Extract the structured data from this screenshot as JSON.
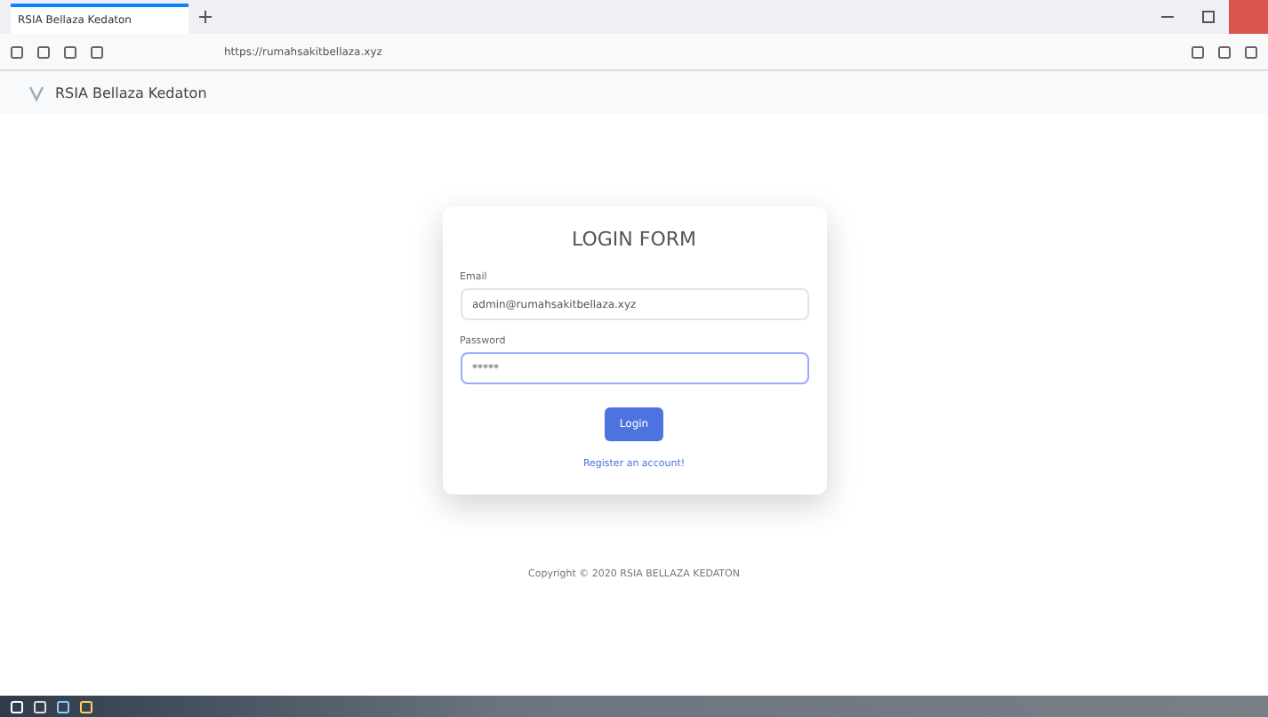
{
  "browser": {
    "tab_title": "RSIA Bellaza Kedaton",
    "url": "https://rumahsakitbellaza.xyz"
  },
  "navbar": {
    "brand": "RSIA Bellaza Kedaton"
  },
  "login": {
    "title": "LOGIN FORM",
    "email_label": "Email",
    "email_value": "admin@rumahsakitbellaza.xyz",
    "password_label": "Password",
    "password_value": "*****",
    "button": "Login",
    "register_link": "Register an account!"
  },
  "footer": "Copyright © 2020 RSIA BELLAZA KEDATON"
}
